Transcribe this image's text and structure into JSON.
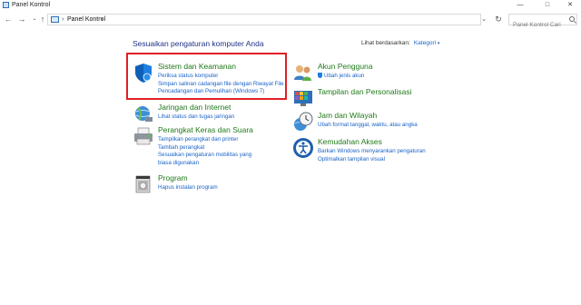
{
  "window": {
    "title": "Panel Kontrol",
    "buttons": {
      "minimize": "—",
      "maximize": "□",
      "close": "✕"
    }
  },
  "address": {
    "back": "←",
    "forward": "→",
    "history": "⌄",
    "up": "↑",
    "crumb_sep1": "›",
    "crumb": "Panel Kontrol",
    "crumb_sep2": "›",
    "dropdown": "⌄",
    "refresh": "↻",
    "search_placeholder": "Panel Kontrol Cari"
  },
  "main": {
    "heading": "Sesuaikan pengaturan komputer Anda",
    "view_by_label": "Lihat berdasarkan:",
    "view_by_value": "Kategori",
    "view_by_caret": "▾",
    "left_categories": [
      {
        "title": "Sistem dan Keamanan",
        "icon": "shield-icon",
        "links": [
          "Periksa status komputer",
          "Simpan salinan cadangan file dengan Riwayat File",
          "Pencadangan dan Pemulihan (Windows 7)"
        ]
      },
      {
        "title": "Jaringan dan Internet",
        "icon": "globe-network-icon",
        "links": [
          "Lihat status dan tugas jaringan"
        ]
      },
      {
        "title": "Perangkat Keras dan Suara",
        "icon": "printer-icon",
        "links": [
          "Tampilkan perangkat dan printer",
          "Tambah perangkat",
          "Sesuaikan pengaturan mobilitas yang biasa digunakan"
        ]
      },
      {
        "title": "Program",
        "icon": "programs-icon",
        "links": [
          "Hapus instalan program"
        ]
      }
    ],
    "right_categories": [
      {
        "title": "Akun Pengguna",
        "icon": "users-icon",
        "links": [
          "Ubah jenis akun"
        ]
      },
      {
        "title": "Tampilan dan Personalisasi",
        "icon": "personalization-icon",
        "links": []
      },
      {
        "title": "Jam dan Wilayah",
        "icon": "clock-globe-icon",
        "links": [
          "Ubah format tanggal, waktu, atau angka"
        ]
      },
      {
        "title": "Kemudahan Akses",
        "icon": "ease-of-access-icon",
        "links": [
          "Barkan Windows menyarankan pengaturan",
          "Optimalkan tampilan visual"
        ]
      }
    ]
  },
  "colors": {
    "category_title": "#1e7a18",
    "link": "#1a63c7",
    "heading": "#1e3287",
    "highlight_border": "#e11f26"
  }
}
